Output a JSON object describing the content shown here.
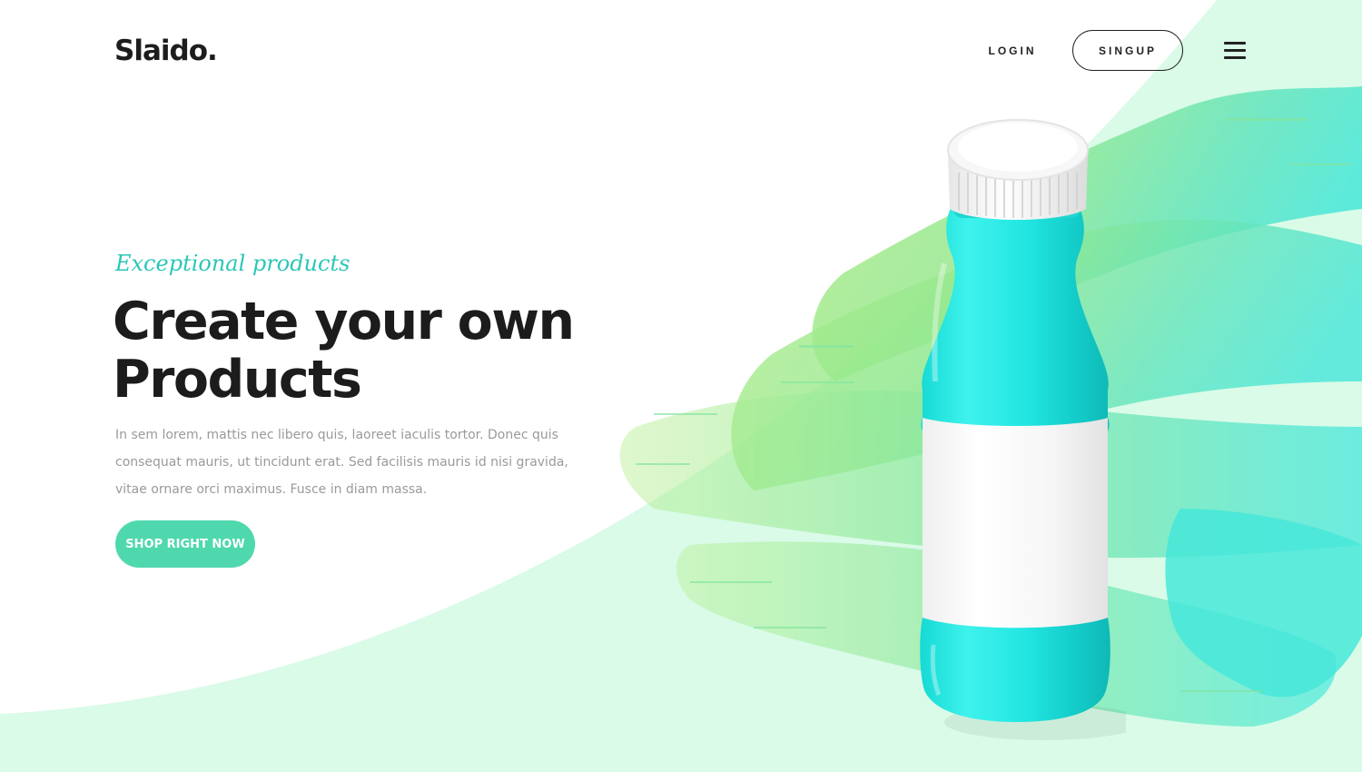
{
  "brand": {
    "logo_text": "Slaido."
  },
  "nav": {
    "login_label": "LOGIN",
    "signup_label": "SINGUP",
    "menu_icon": "hamburger-menu-icon"
  },
  "hero": {
    "eyebrow": "Exceptional products",
    "headline_line1": "Create your own",
    "headline_line2": "Products",
    "body": "In sem lorem, mattis nec libero quis, laoreet iaculis tortor. Donec quis consequat mauris, ut tincidunt erat. Sed facilisis mauris id nisi gravida, vitae ornare orci maximus. Fusce in diam massa.",
    "cta_label": "SHOP RIGHT NOW"
  },
  "colors": {
    "accent_teal": "#2cc7b8",
    "button_mint": "#4fd8ae",
    "background_mint": "#d9fbe8",
    "bottle_cyan": "#27e6e0",
    "brush_green": "#8ee68a",
    "text_dark": "#1c1c1c",
    "text_muted": "#9a9a9a"
  }
}
